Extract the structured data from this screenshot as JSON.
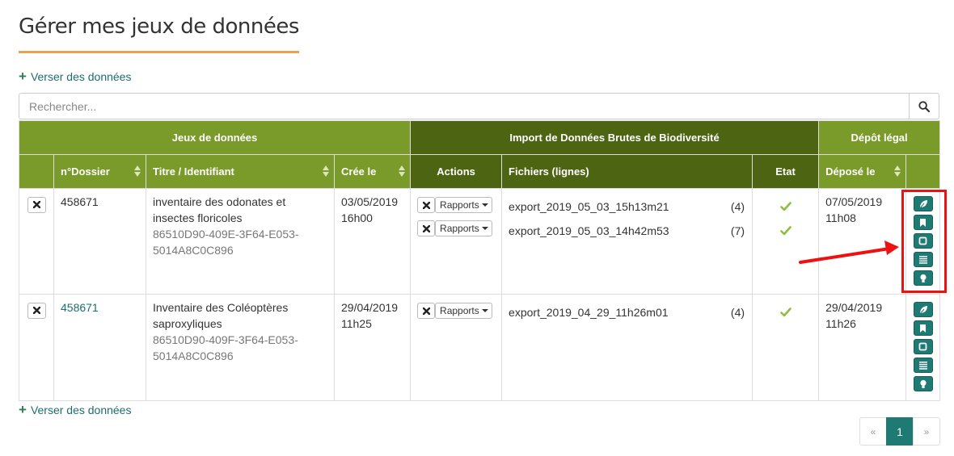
{
  "page": {
    "title": "Gérer mes jeux de données",
    "add_link_label": "Verser des données"
  },
  "search": {
    "placeholder": "Rechercher..."
  },
  "table": {
    "group_headers": [
      "Jeux de données",
      "Import de Données Brutes de Biodiversité",
      "Dépôt légal"
    ],
    "column_headers": {
      "dossier": "n°Dossier",
      "titre": "Titre / Identifiant",
      "cree": "Crée le",
      "actions": "Actions",
      "fichiers": "Fichiers (lignes)",
      "etat": "Etat",
      "depose": "Déposé le"
    },
    "rows": [
      {
        "dossier": "458671",
        "dossier_is_link": false,
        "title": "inventaire des odonates et insectes floricoles",
        "identifier": "86510D90-409E-3F64-E053-5014A8C0C896",
        "created": "03/05/2019 16h00",
        "files": [
          {
            "name": "export_2019_05_03_15h13m21",
            "count": "(4)",
            "rapports_label": "Rapports",
            "status": "ok"
          },
          {
            "name": "export_2019_05_03_14h42m53",
            "count": "(7)",
            "rapports_label": "Rapports",
            "status": "ok"
          }
        ],
        "deposited": "07/05/2019 11h08"
      },
      {
        "dossier": "458671",
        "dossier_is_link": true,
        "title": "Inventaire des Coléoptères saproxyliques",
        "identifier": "86510D90-409F-3F64-E053-5014A8C0C896",
        "created": "29/04/2019 11h25",
        "files": [
          {
            "name": "export_2019_04_29_11h26m01",
            "count": "(4)",
            "rapports_label": "Rapports",
            "status": "ok"
          }
        ],
        "deposited": "29/04/2019 11h26"
      }
    ],
    "row_icons": [
      "leaf-icon",
      "bookmark-icon",
      "square-icon",
      "list-icon",
      "bulb-icon"
    ]
  },
  "pagination": {
    "prev": "«",
    "current": "1",
    "next": "»"
  },
  "colors": {
    "header_olive": "#7a9a2a",
    "header_dark": "#4d6412",
    "teal_button": "#1f7a74",
    "title_underline": "#f0a04b",
    "check_green": "#8cbf3f",
    "annotation_red": "#ee1111"
  }
}
